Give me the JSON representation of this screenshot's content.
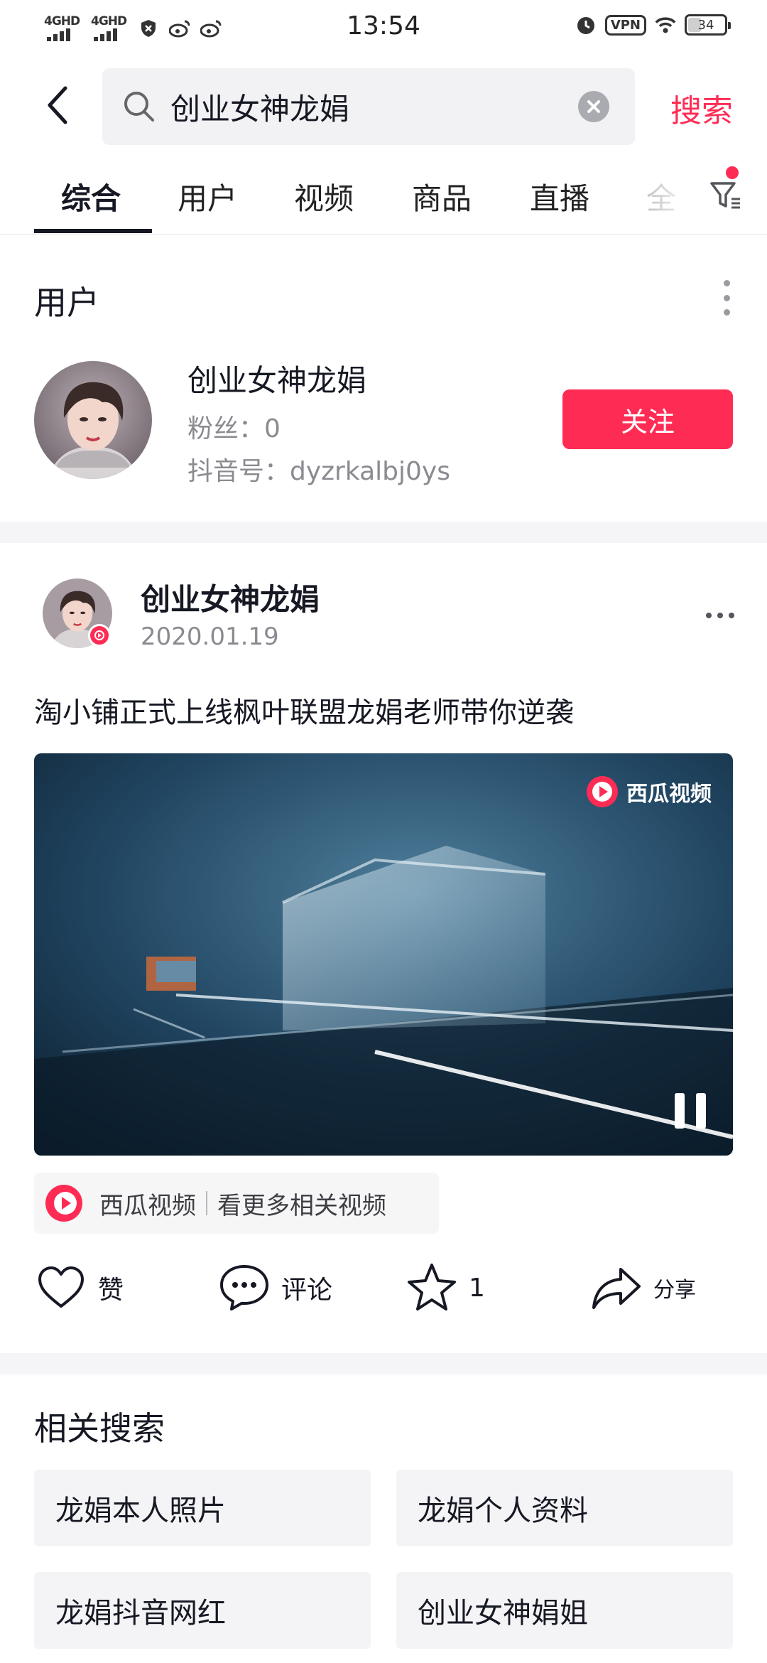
{
  "status_bar": {
    "time": "13:54",
    "network_1": "4GHD",
    "network_2": "4GHD",
    "vpn": "VPN",
    "battery": "34",
    "battery_level": 0.34
  },
  "search": {
    "query": "创业女神龙娟",
    "submit_label": "搜索"
  },
  "tabs": [
    {
      "label": "综合",
      "active": true
    },
    {
      "label": "用户"
    },
    {
      "label": "视频"
    },
    {
      "label": "商品"
    },
    {
      "label": "直播"
    },
    {
      "label": "全"
    }
  ],
  "users_section": {
    "title": "用户",
    "user": {
      "name": "创业女神龙娟",
      "fans": "粉丝：0",
      "douyin_id": "抖音号：dyzrkalbj0ys",
      "follow_label": "关注"
    }
  },
  "post": {
    "author": "创业女神龙娟",
    "date": "2020.01.19",
    "caption": "淘小铺正式上线枫叶联盟龙娟老师带你逆袭",
    "video_watermark": "西瓜视频",
    "source_name": "西瓜视频",
    "source_more": "看更多相关视频",
    "actions": {
      "like": "赞",
      "comment": "评论",
      "favorite": "1",
      "share": "分享"
    }
  },
  "related": {
    "title": "相关搜索",
    "items": [
      "龙娟本人照片",
      "龙娟个人资料",
      "龙娟抖音网红",
      "创业女神娟姐"
    ]
  },
  "colors": {
    "accent": "#fe2c55",
    "text_primary": "#161823",
    "text_secondary": "#8a8b91",
    "divider": "#f5f5f7"
  }
}
